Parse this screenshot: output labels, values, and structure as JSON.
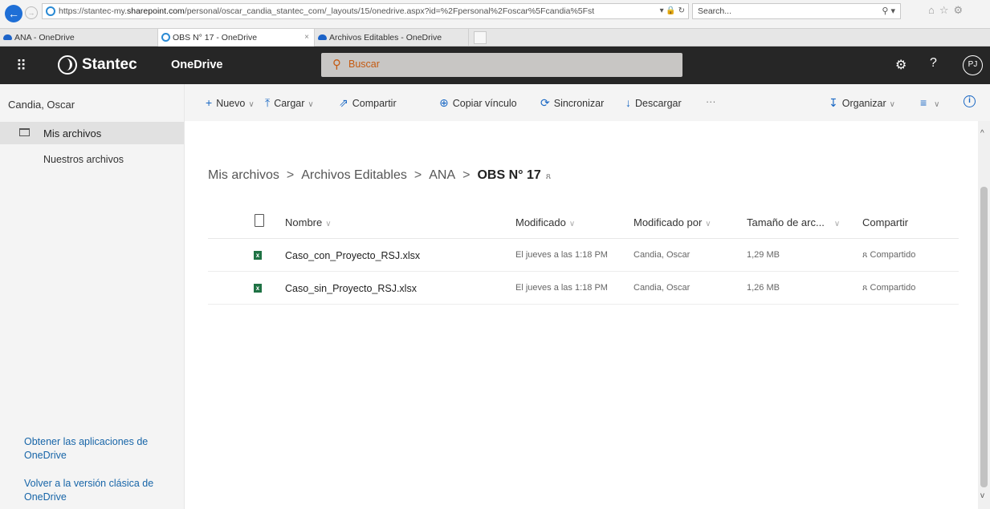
{
  "browser": {
    "url_prefix": "https://stantec-my.",
    "url_host": "sharepoint.com",
    "url_path": "/personal/oscar_candia_stantec_com/_layouts/15/onedrive.aspx?id=%2Fpersonal%2Foscar%5Fcandia%5Fst",
    "url_controls": "▾ 🔒 ↻",
    "search_placeholder": "Search...",
    "search_icon": "⚲ ▾",
    "toolbar_icons": "⌂☆⚙",
    "tabs": [
      {
        "label": "ANA - OneDrive"
      },
      {
        "label": "OBS N° 17 - OneDrive"
      },
      {
        "label": "Archivos Editables - OneDrive"
      }
    ],
    "tab_close": "×"
  },
  "suite": {
    "waffle": "⠿",
    "brand": "Stantec",
    "app_name": "OneDrive",
    "search_icon": "⚲",
    "search_placeholder": "Buscar",
    "gear": "⚙",
    "help": "?",
    "avatar": "PJ"
  },
  "leftnav": {
    "user": "Candia, Oscar",
    "my_files": "Mis archivos",
    "our_files": "Nuestros archivos",
    "get_apps": "Obtener las aplicaciones de OneDrive",
    "classic": "Volver a la versión clásica de OneDrive"
  },
  "cmdbar": {
    "new": "Nuevo",
    "upload": "Cargar",
    "share": "Compartir",
    "copy_link": "Copiar vínculo",
    "sync": "Sincronizar",
    "download": "Descargar",
    "more": "···",
    "sort": "Organizar",
    "view": "≡",
    "info": "i",
    "icons": {
      "new": "+",
      "upload": "⤒",
      "share": "⇗",
      "copy_link": "⊕",
      "sync": "⟳",
      "download": "↓",
      "sort": "↧"
    },
    "chevron": "∨"
  },
  "breadcrumb": {
    "items": [
      "Mis archivos",
      "Archivos Editables",
      "ANA"
    ],
    "current": "OBS N° 17",
    "sep": ">",
    "share_icon": "ጸ"
  },
  "table": {
    "headers": {
      "name": "Nombre",
      "modified": "Modificado",
      "modified_by": "Modificado por",
      "size": "Tamaño de arc...",
      "share": "Compartir"
    },
    "chevron": "∨",
    "rows": [
      {
        "name": "Caso_con_Proyecto_RSJ.xlsx",
        "modified": "El jueves a las 1:18 PM",
        "modified_by": "Candia, Oscar",
        "size": "1,29 MB",
        "share": "ጸ Compartido"
      },
      {
        "name": "Caso_sin_Proyecto_RSJ.xlsx",
        "modified": "El jueves a las 1:18 PM",
        "modified_by": "Candia, Oscar",
        "size": "1,26 MB",
        "share": "ጸ Compartido"
      }
    ],
    "xl_letter": "x"
  },
  "scroll": {
    "up": "^",
    "down": "v"
  },
  "colors": {
    "suite_bg": "#262626",
    "accent": "#1a68c4",
    "search_text": "#c55a11",
    "excel": "#1f7244"
  }
}
